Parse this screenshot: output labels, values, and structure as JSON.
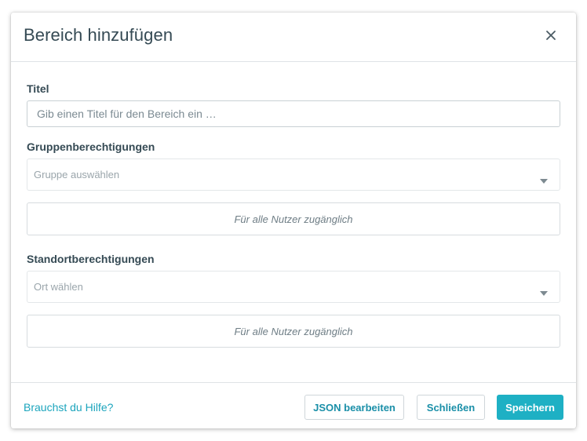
{
  "dialog": {
    "title": "Bereich hinzufügen",
    "close_icon": "close-icon"
  },
  "form": {
    "title_field": {
      "label": "Titel",
      "value": "",
      "placeholder": "Gib einen Titel für den Bereich ein …"
    },
    "group_permissions": {
      "label": "Gruppenberechtigungen",
      "select_placeholder": "Gruppe auswählen",
      "info_text": "Für alle Nutzer zugänglich"
    },
    "location_permissions": {
      "label": "Standortberechtigungen",
      "select_placeholder": "Ort wählen",
      "info_text": "Für alle Nutzer zugänglich"
    }
  },
  "footer": {
    "help_link": "Brauchst du Hilfe?",
    "json_button": "JSON bearbeiten",
    "close_button": "Schließen",
    "save_button": "Speichern"
  },
  "colors": {
    "accent": "#1eb0c4",
    "link": "#1ca5bd",
    "text": "#354a54"
  }
}
